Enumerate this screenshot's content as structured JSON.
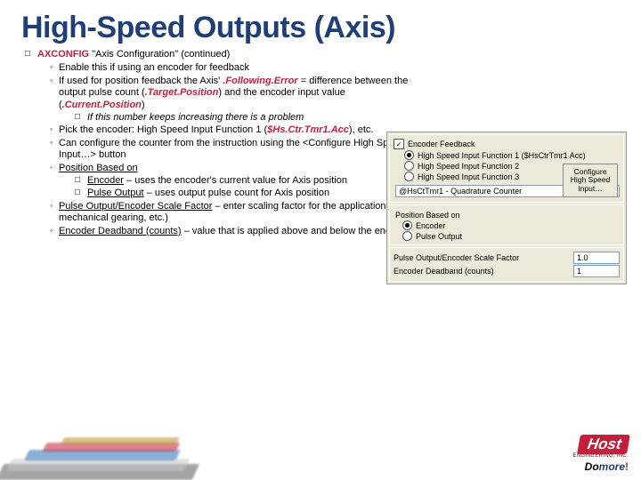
{
  "title": "High-Speed Outputs (Axis)",
  "l1": {
    "axconfig": "AXCONFIG",
    "rest": " \"Axis Configuration\" (continued)"
  },
  "b1": "Enable this if using an encoder for feedback",
  "b2": {
    "a": "If used for position feedback the Axis' ",
    "fe": ".Following.Error",
    "b": " = difference between the output pulse count (",
    "tp": ".Target.Position",
    "c": ") and the encoder input value (",
    "cp": ".Current.Position",
    "d": ")"
  },
  "b2s": "If this number keeps increasing there is a problem",
  "b3": {
    "a": "Pick the encoder: High Speed Input Function 1 (",
    "hs": "$Hs.Ctr.Tmr1.Acc",
    "b": "), etc."
  },
  "b4": "Can configure the counter from the instruction using the <Configure High Speed Input…> button",
  "b5": "Position Based on",
  "b5a": {
    "u": "Encoder",
    "r": " – uses the encoder's current value for Axis position"
  },
  "b5b": {
    "u": "Pulse Output",
    "r": " – uses output pulse count for Axis position"
  },
  "b6": {
    "u": "Pulse Output/Encoder Scale Factor",
    "r": " – enter scaling factor for the application (e.g. motor's ppr / encoder ppr; or there could be mechanical gearing, etc.)"
  },
  "b7": {
    "u": "Encoder Deadband (counts)",
    "r": " – value that is applied above and below the encoder value; helps prevent \"seeking\""
  },
  "shot": {
    "enc": "Encoder Feedback",
    "o1": "High Speed Input Function 1   ($HsCtrTmr1 Acc)",
    "o2": "High Speed Input Function 2",
    "o3": "High Speed Input Function 3",
    "sel": "@HsCtTmr1 - Quadrature Counter",
    "btn": "Configure High Speed Input…",
    "pb": "Position Based on",
    "pbo1": "Encoder",
    "pbo2": "Pulse Output",
    "sf": "Pulse Output/Encoder Scale Factor",
    "sfv": "1.0",
    "db": "Encoder Deadband (counts)",
    "dbv": "1"
  },
  "logo": {
    "host": "Host",
    "eng": "ENGINEERING, INC.",
    "do": "Do",
    "more": "more",
    "ex": "!"
  }
}
